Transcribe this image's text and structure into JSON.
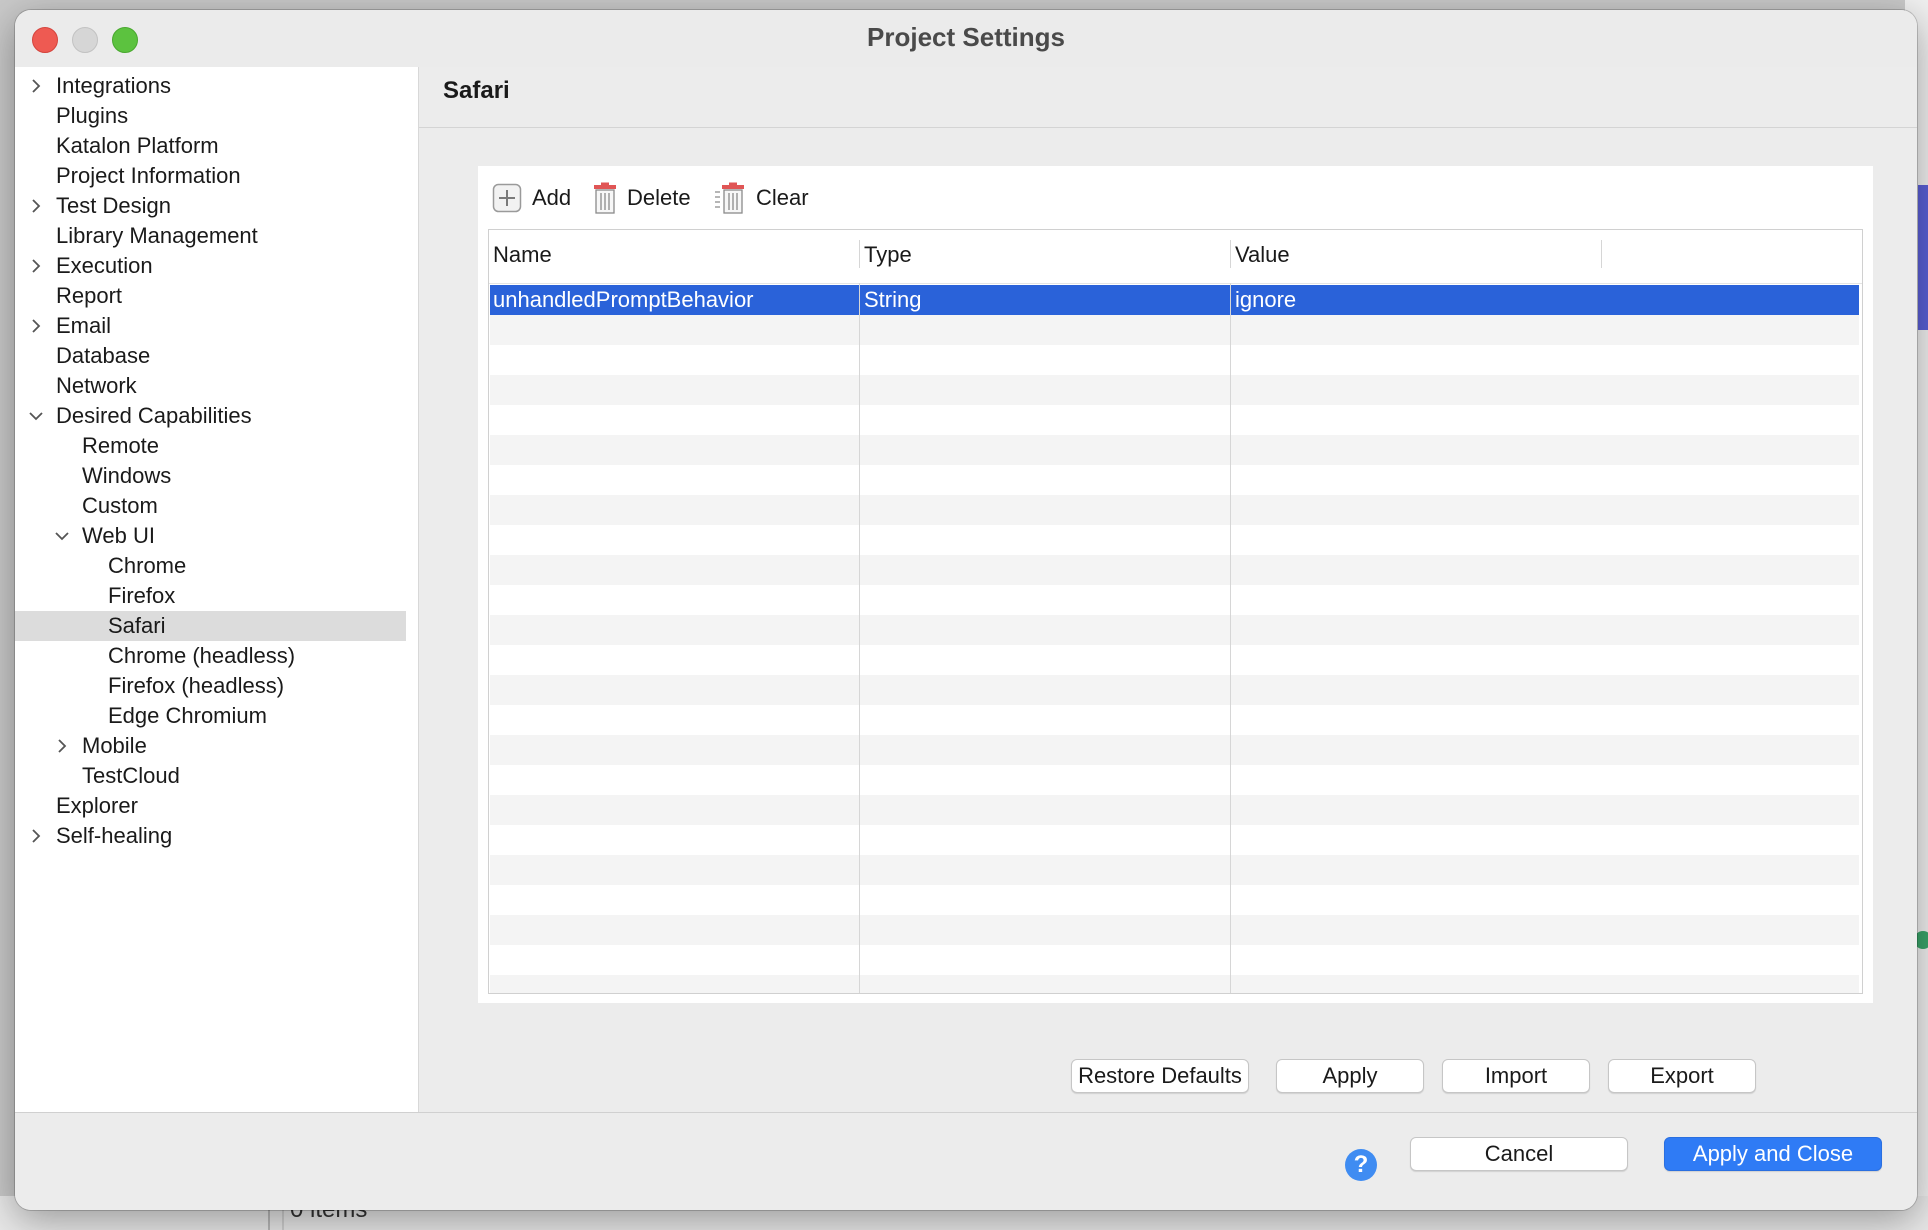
{
  "window": {
    "title": "Project Settings"
  },
  "sidebar": {
    "items": [
      {
        "label": "Integrations",
        "chevron": "right"
      },
      {
        "label": "Plugins"
      },
      {
        "label": "Katalon Platform"
      },
      {
        "label": "Project Information"
      },
      {
        "label": "Test Design",
        "chevron": "right"
      },
      {
        "label": "Library Management"
      },
      {
        "label": "Execution",
        "chevron": "right"
      },
      {
        "label": "Report"
      },
      {
        "label": "Email",
        "chevron": "right"
      },
      {
        "label": "Database"
      },
      {
        "label": "Network"
      },
      {
        "label": "Desired Capabilities",
        "chevron": "down"
      },
      {
        "label": "Remote"
      },
      {
        "label": "Windows"
      },
      {
        "label": "Custom"
      },
      {
        "label": "Web UI",
        "chevron": "down"
      },
      {
        "label": "Chrome"
      },
      {
        "label": "Firefox"
      },
      {
        "label": "Safari",
        "selected": true
      },
      {
        "label": "Chrome (headless)"
      },
      {
        "label": "Firefox (headless)"
      },
      {
        "label": "Edge Chromium"
      },
      {
        "label": "Mobile",
        "chevron": "right"
      },
      {
        "label": "TestCloud"
      },
      {
        "label": "Explorer"
      },
      {
        "label": "Self-healing",
        "chevron": "right"
      }
    ]
  },
  "main": {
    "section_title": "Safari",
    "toolbar": {
      "add_label": "Add",
      "delete_label": "Delete",
      "clear_label": "Clear"
    },
    "table": {
      "columns": [
        "Name",
        "Type",
        "Value"
      ],
      "rows": [
        {
          "name": "unhandledPromptBehavior",
          "type": "String",
          "value": "ignore",
          "selected": true
        }
      ]
    },
    "buttons": {
      "restore_defaults": "Restore Defaults",
      "apply": "Apply",
      "import": "Import",
      "export": "Export"
    }
  },
  "footer": {
    "help_icon": "?",
    "cancel": "Cancel",
    "apply_and_close": "Apply and Close"
  },
  "background": {
    "status_text": "0 items"
  },
  "colors": {
    "selection": "#2a62d9",
    "primary_button": "#2f7bf5",
    "close": "#ee5a52",
    "zoom": "#5cc23f"
  }
}
